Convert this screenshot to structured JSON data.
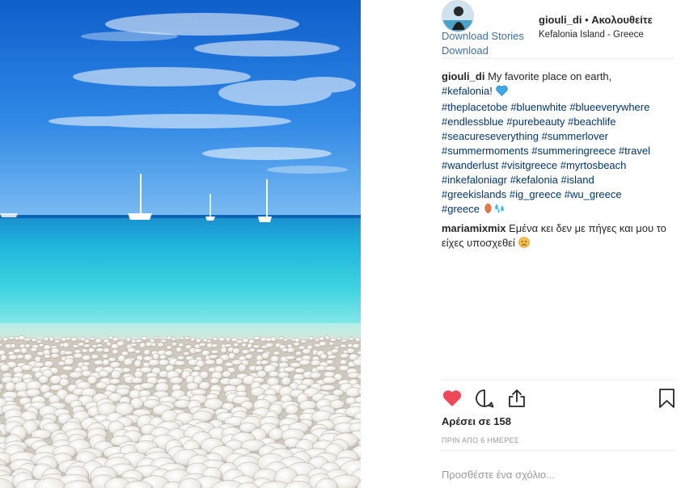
{
  "post": {
    "username": "giouli_di",
    "separator": "•",
    "follow_label": "Ακολουθείτε",
    "location": "Kefalonia Island - Greece",
    "download_stories_label": "Download Stories",
    "download_label": "Download"
  },
  "caption": {
    "username": "giouli_di",
    "text": "My favorite place on earth,",
    "first_tag": "#kefalonia!",
    "emoji_heart": "blue-heart",
    "lines": [
      [
        "#theplacetobe",
        "#bluenwhite",
        "#blueeverywhere"
      ],
      [
        "#endlessblue",
        "#purebeauty",
        "#beachlife"
      ],
      [
        "#seacureseverything",
        "#summerlover"
      ],
      [
        "#summermoments",
        "#summeringreece",
        "#travel"
      ],
      [
        "#wanderlust",
        "#visitgreece",
        "#myrtosbeach"
      ],
      [
        "#inkefaloniagr",
        "#kefalonia",
        "#island"
      ],
      [
        "#greekislands",
        "#ig_greece",
        "#wu_greece"
      ],
      [
        "#greece"
      ]
    ],
    "end_emojis": [
      "shell",
      "droplets"
    ]
  },
  "comments": [
    {
      "username": "mariamixmix",
      "text": "Εμένα κει δεν με πήγες και μου το είχες υποσχεθεί",
      "emoji": "disappointed-face"
    }
  ],
  "actions": {
    "like_icon": "heart-filled-icon",
    "comment_icon": "comment-icon",
    "share_icon": "share-icon",
    "save_icon": "bookmark-icon",
    "like_color": "#ed4956"
  },
  "likes_text": "Αρέσει σε 158",
  "time_text": "ΠΡΙΝ ΑΠΟ 6 ΗΜΕΡΕΣ",
  "add_comment": {
    "placeholder": "Προσθέστε ένα σχόλιο..."
  },
  "colors": {
    "link": "#003569",
    "download": "#3f6f9e",
    "sky": "#1a6fd6",
    "sea": "#3fd4e0"
  }
}
